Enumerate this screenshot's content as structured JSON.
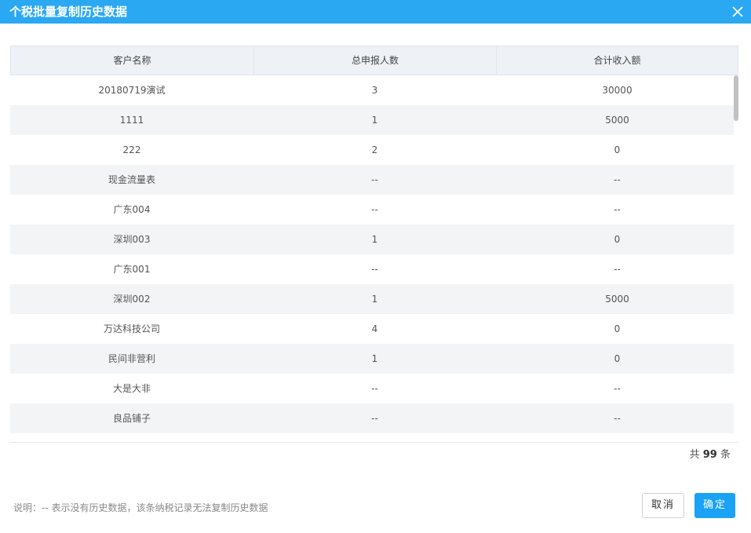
{
  "dialog": {
    "title": "个税批量复制历史数据",
    "close_icon": "close-icon"
  },
  "table": {
    "columns": [
      "客户名称",
      "总申报人数",
      "合计收入额"
    ],
    "rows": [
      [
        "20180719演试",
        "3",
        "30000"
      ],
      [
        "1111",
        "1",
        "5000"
      ],
      [
        "222",
        "2",
        "0"
      ],
      [
        "现金流量表",
        "--",
        "--"
      ],
      [
        "广东004",
        "--",
        "--"
      ],
      [
        "深圳003",
        "1",
        "0"
      ],
      [
        "广东001",
        "--",
        "--"
      ],
      [
        "深圳002",
        "1",
        "5000"
      ],
      [
        "万达科技公司",
        "4",
        "0"
      ],
      [
        "民间非营利",
        "1",
        "0"
      ],
      [
        "大是大非",
        "--",
        "--"
      ],
      [
        "良品铺子",
        "--",
        "--"
      ]
    ]
  },
  "footer": {
    "total_prefix": "共",
    "total_count": "99",
    "total_suffix": "条",
    "note": "说明：-- 表示没有历史数据，该条纳税记录无法复制历史数据",
    "cancel_label": "取消",
    "ok_label": "确定"
  },
  "colors": {
    "titlebar": "#2aa8f2",
    "primary_button": "#1aa3f5",
    "header_bg": "#eef1f6",
    "stripe_bg": "#f3f4f6"
  }
}
